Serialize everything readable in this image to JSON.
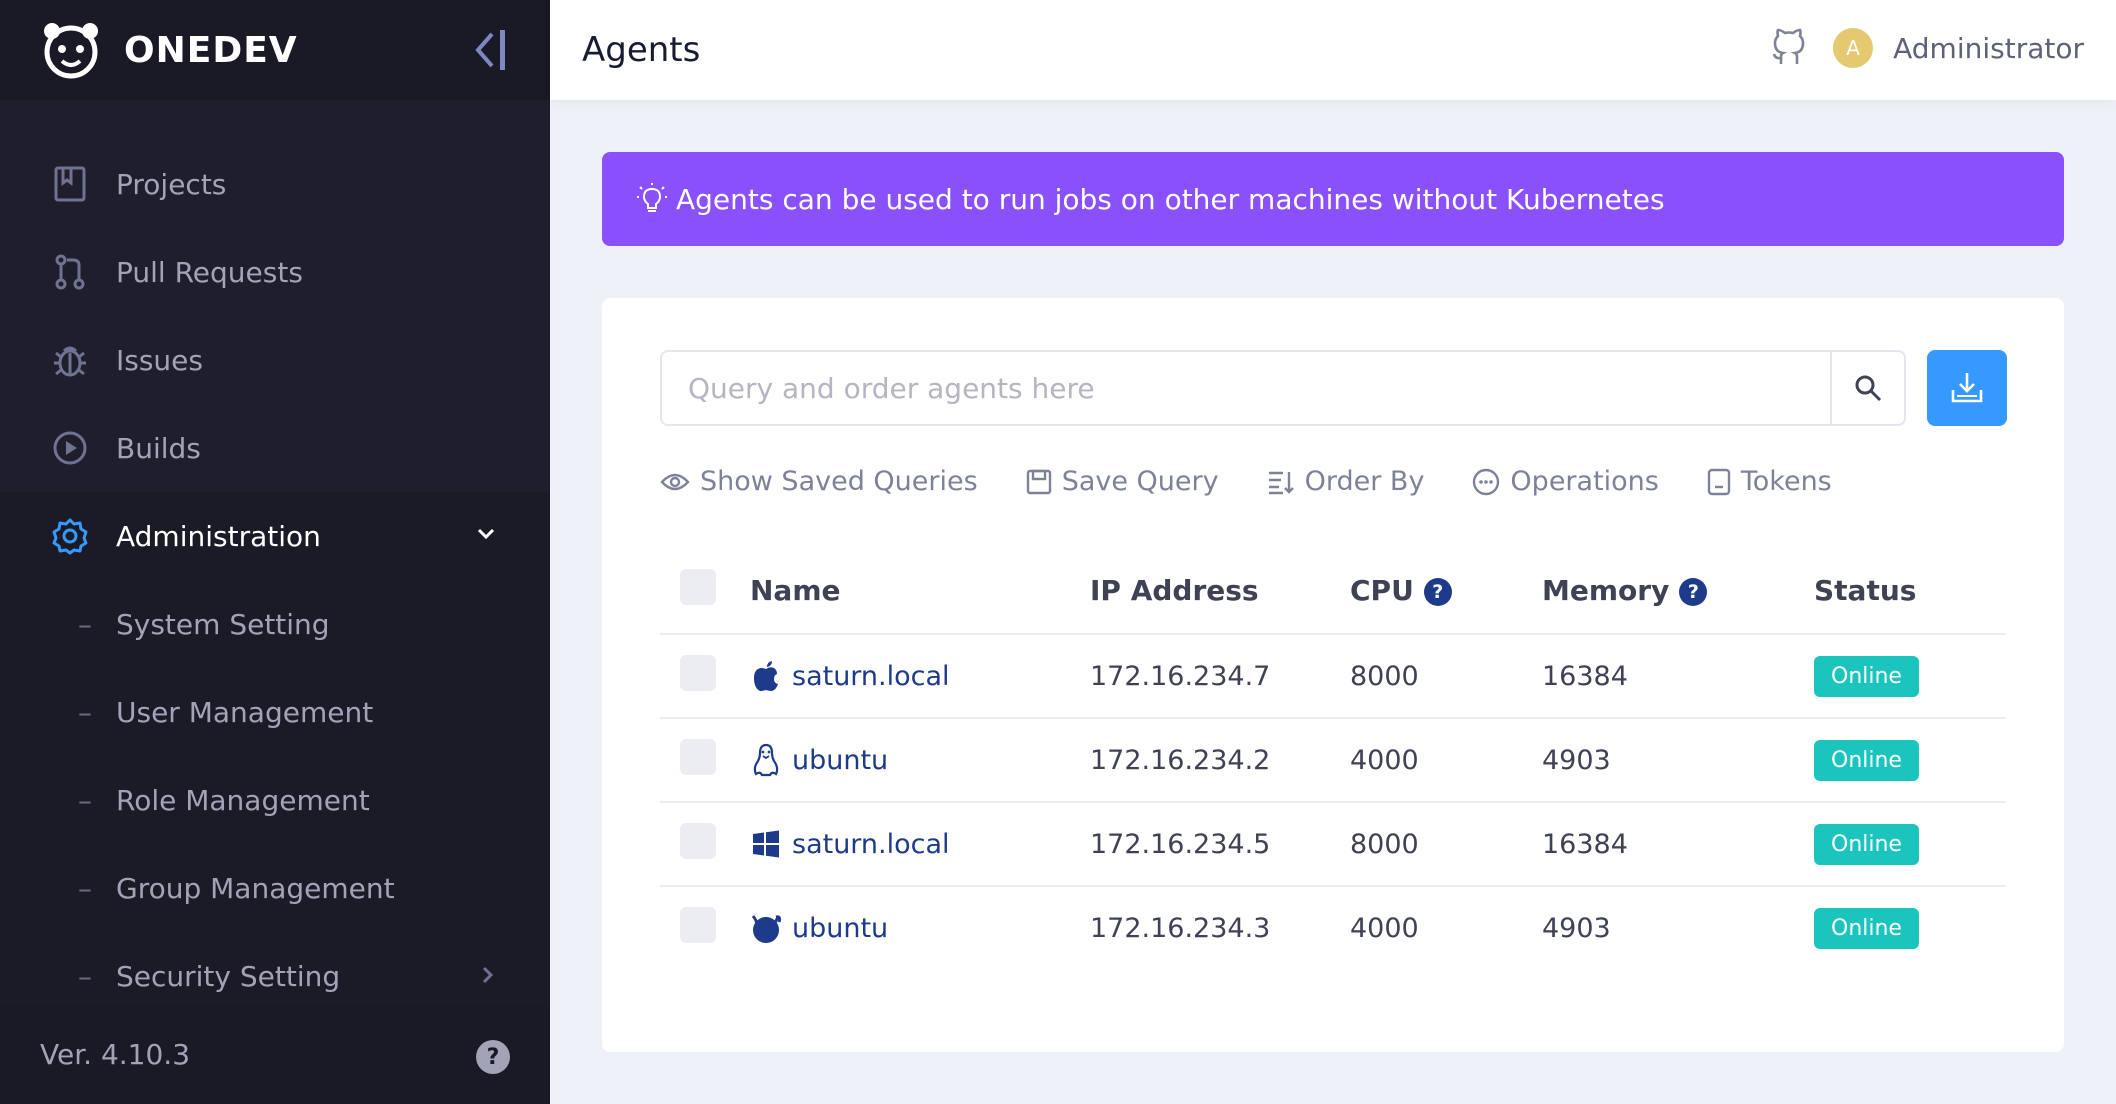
{
  "sidebar": {
    "brand": "ONEDEV",
    "items": [
      {
        "label": "Projects",
        "icon": "book-icon"
      },
      {
        "label": "Pull Requests",
        "icon": "pull-request-icon"
      },
      {
        "label": "Issues",
        "icon": "bug-icon"
      },
      {
        "label": "Builds",
        "icon": "play-circle-icon"
      },
      {
        "label": "Administration",
        "icon": "gear-icon"
      }
    ],
    "subitems": [
      "System Setting",
      "User Management",
      "Role Management",
      "Group Management",
      "Security Setting"
    ],
    "version": "Ver. 4.10.3",
    "help": "?"
  },
  "header": {
    "title": "Agents",
    "avatar_initial": "A",
    "user": "Administrator"
  },
  "banner": {
    "text": "Agents can be used to run jobs on other machines without Kubernetes"
  },
  "search": {
    "placeholder": "Query and order agents here"
  },
  "actions": [
    "Show Saved Queries",
    "Save Query",
    "Order By",
    "Operations",
    "Tokens"
  ],
  "table": {
    "columns": [
      "Name",
      "IP Address",
      "CPU",
      "Memory",
      "Status"
    ],
    "rows": [
      {
        "os": "apple-icon",
        "name": "saturn.local",
        "ip": "172.16.234.7",
        "cpu": "8000",
        "memory": "16384",
        "status": "Online"
      },
      {
        "os": "linux-icon",
        "name": "ubuntu",
        "ip": "172.16.234.2",
        "cpu": "4000",
        "memory": "4903",
        "status": "Online"
      },
      {
        "os": "windows-icon",
        "name": "saturn.local",
        "ip": "172.16.234.5",
        "cpu": "8000",
        "memory": "16384",
        "status": "Online"
      },
      {
        "os": "freebsd-icon",
        "name": "ubuntu",
        "ip": "172.16.234.3",
        "cpu": "4000",
        "memory": "4903",
        "status": "Online"
      }
    ]
  },
  "colors": {
    "sidebar_bg": "#1e1e2d",
    "banner_bg": "#8950fc",
    "primary": "#3699ff",
    "success": "#1bc5bd",
    "link": "#1e3a8a"
  }
}
